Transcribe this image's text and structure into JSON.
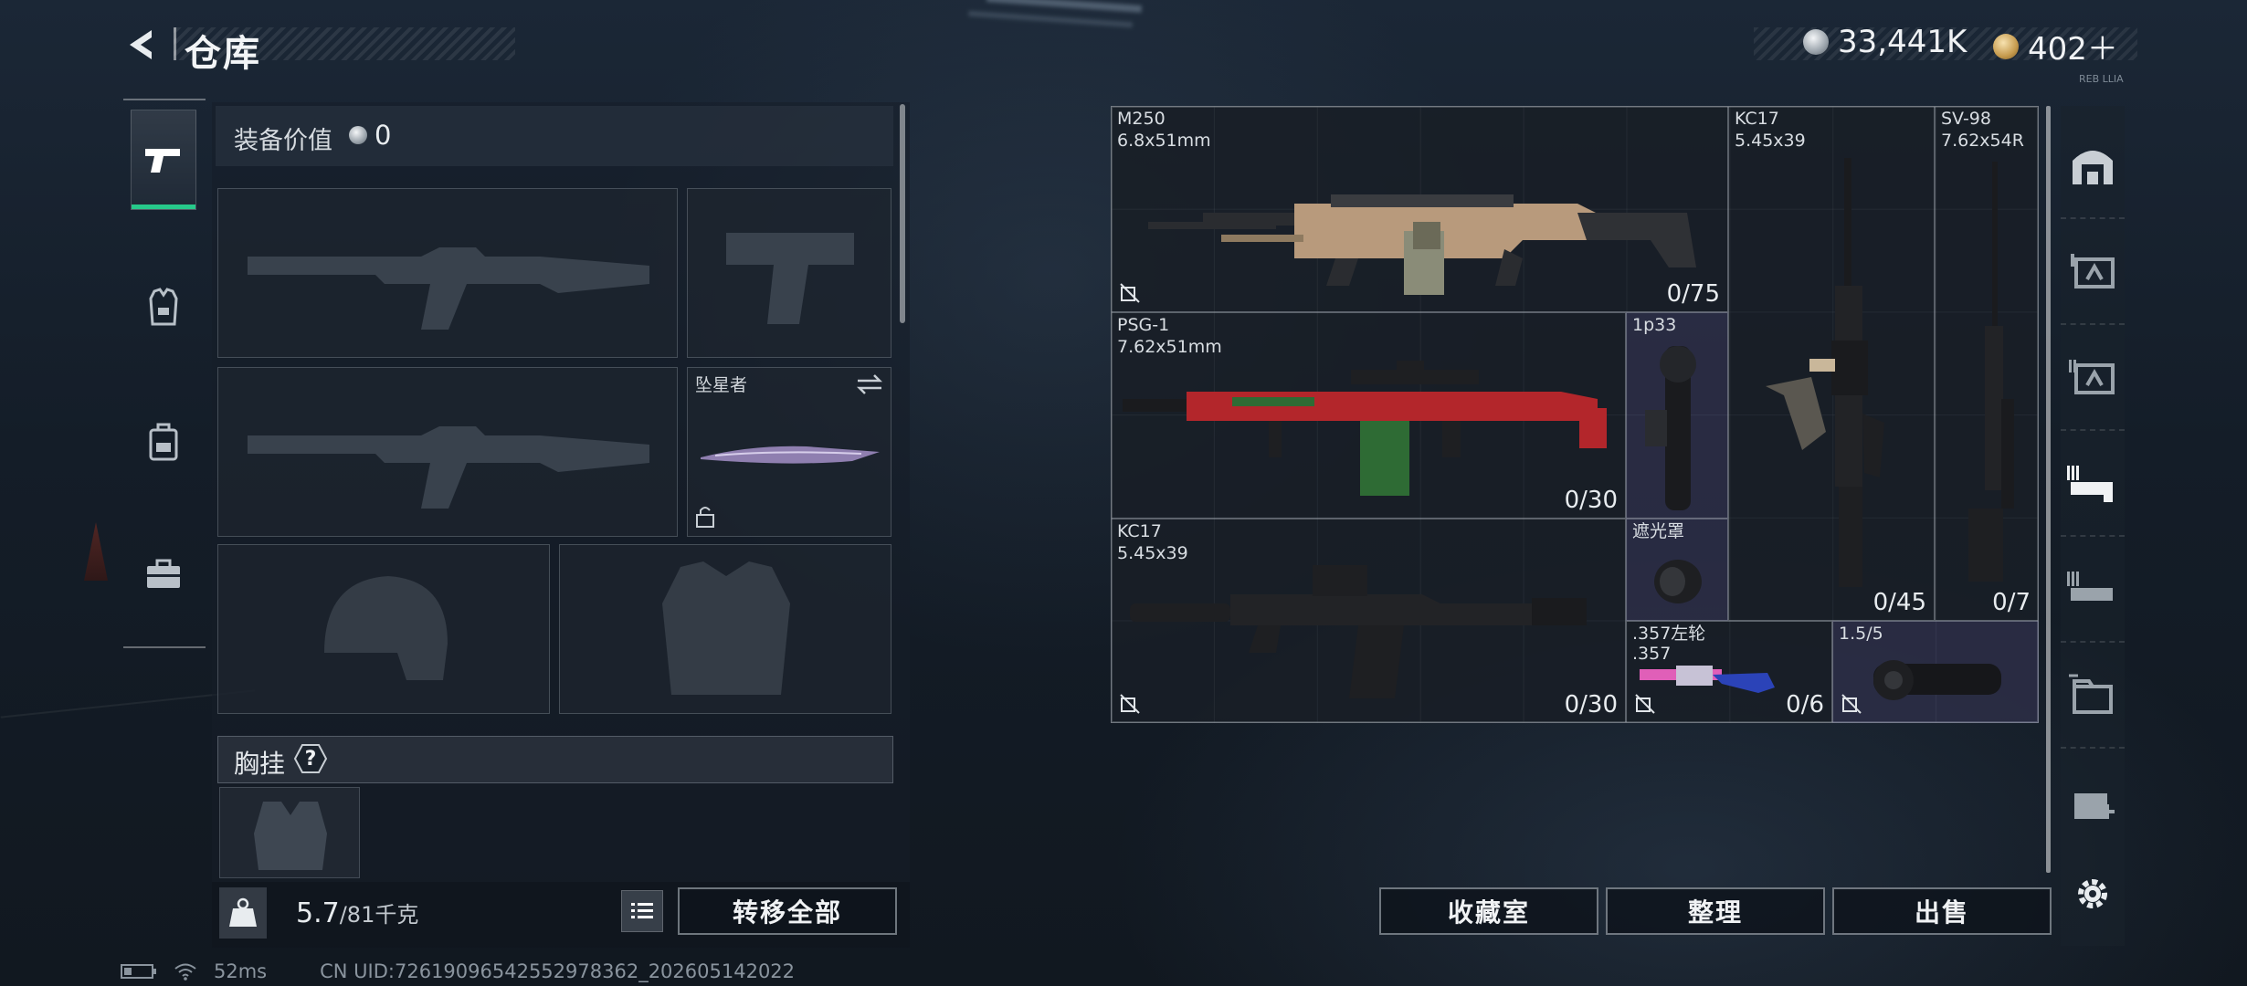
{
  "header": {
    "title": "仓库"
  },
  "currency": {
    "silver_amount": "33,441K",
    "gold_amount": "402＋",
    "tiny_label": "REB LLIA"
  },
  "equipment": {
    "value_label": "装备价值",
    "value_amount": "0",
    "melee_name": "坠星者",
    "chest_label": "胸挂",
    "help_label": "?"
  },
  "weight": {
    "current": "5.7",
    "max": "/81千克"
  },
  "buttons": {
    "transfer_all": "转移全部",
    "collection_room": "收藏室",
    "organize": "整理",
    "sell": "出售"
  },
  "storage_items": [
    {
      "name": "M250",
      "caliber": "6.8x51mm",
      "ammo": "0/75"
    },
    {
      "name": "KC17",
      "caliber": "5.45x39",
      "ammo": "0/45"
    },
    {
      "name": "SV-98",
      "caliber": "7.62x54R",
      "ammo": "0/7"
    },
    {
      "name": "PSG-1",
      "caliber": "7.62x51mm",
      "ammo": "0/30"
    },
    {
      "name": "1p33",
      "caliber": "",
      "ammo": ""
    },
    {
      "name": "KC17",
      "caliber": "5.45x39",
      "ammo": "0/30"
    },
    {
      "name": "遮光罩",
      "caliber": "",
      "ammo": ""
    },
    {
      "name": ".357左轮",
      "caliber": ".357",
      "ammo": "0/6"
    },
    {
      "name": "1.5/5",
      "caliber": "",
      "ammo": ""
    }
  ],
  "right_tabs": [
    "all-storage",
    "tier-1",
    "tier-2",
    "tier-3",
    "tier-3-alt",
    "tier-4",
    "tier-4-add"
  ],
  "status": {
    "ping": "52ms",
    "uid": "CN UID:7261909654255297836​2_202605142022"
  },
  "colors": {
    "accent_green": "#27c98a",
    "panel_border": "#aab2ba",
    "purple_item": "#3a3a5c"
  }
}
